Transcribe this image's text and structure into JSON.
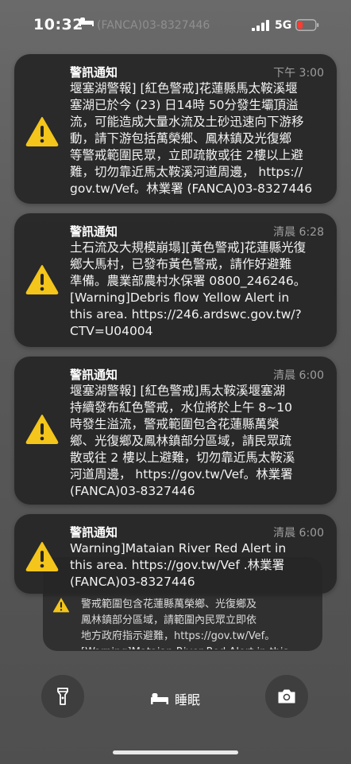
{
  "status_bar": {
    "time": "10:32",
    "network": "5G",
    "background_text": "(FANCA)03-8327446"
  },
  "notifications": [
    {
      "title": "警訊通知",
      "time": "下午 3:00",
      "body": "堰塞湖警報] [紅色警戒]花蓮縣馬太鞍溪堰\n塞湖已於今 (23) 日14時 50分發生壩頂溢\n流，可能造成大量水流及土砂迅速向下游移\n動，請下游包括萬榮鄉、鳳林鎮及光復鄉\n等警戒範圍民眾，立即疏散或往 2樓以上避\n難，切勿靠近馬太鞍溪河道周邊，  https://\ngov.tw/Vef。林業署 (FANCA)03-8327446"
    },
    {
      "title": "警訊通知",
      "time": "清晨 6:28",
      "body": "土石流及大規模崩塌][黃色警戒]花蓮縣光復\n鄉大馬村，已發布黃色警戒，請作好避難\n準備。農業部農村水保署 0800_246246。\n[Warning]Debris flow Yellow Alert in\nthis area. https://246.ardswc.gov.tw/?\nCTV=U04004"
    },
    {
      "title": "警訊通知",
      "time": "清晨 6:00",
      "body": "堰塞湖警報] [紅色警戒]馬太鞍溪堰塞湖\n持續發布紅色警戒，水位將於上午 8~10\n時發生溢流，警戒範圍包含花蓮縣萬榮\n鄉、光復鄉及鳳林鎮部分區域，請民眾疏\n散或往 2 樓以上避難，切勿靠近馬太鞍溪\n河道周邊，   https://gov.tw/Vef。林業署\n(FANCA)03-8327446"
    },
    {
      "title": "警訊通知",
      "time": "清晨 6:00",
      "body": "Warning]Mataian River Red Alert in\nthis area. https://gov.tw/Vef .林業署\n(FANCA)03-8327446"
    }
  ],
  "stacked_notification": {
    "body": "警戒範圍包含花蓮縣萬榮鄉、光復鄉及\n鳳林鎮部分區域，請範圍內民眾立即依\n地方政府指示避難，https://gov.tw/Vef。\n[Warning]Mataian River Red Alert in this"
  },
  "bottom": {
    "sleep_label": "睡眠",
    "left_icon": "flashlight-icon",
    "right_icon": "camera-icon"
  },
  "colors": {
    "warning_yellow": "#f4c51a",
    "card_bg": "#262626",
    "time_gray": "#9d9d9d"
  }
}
